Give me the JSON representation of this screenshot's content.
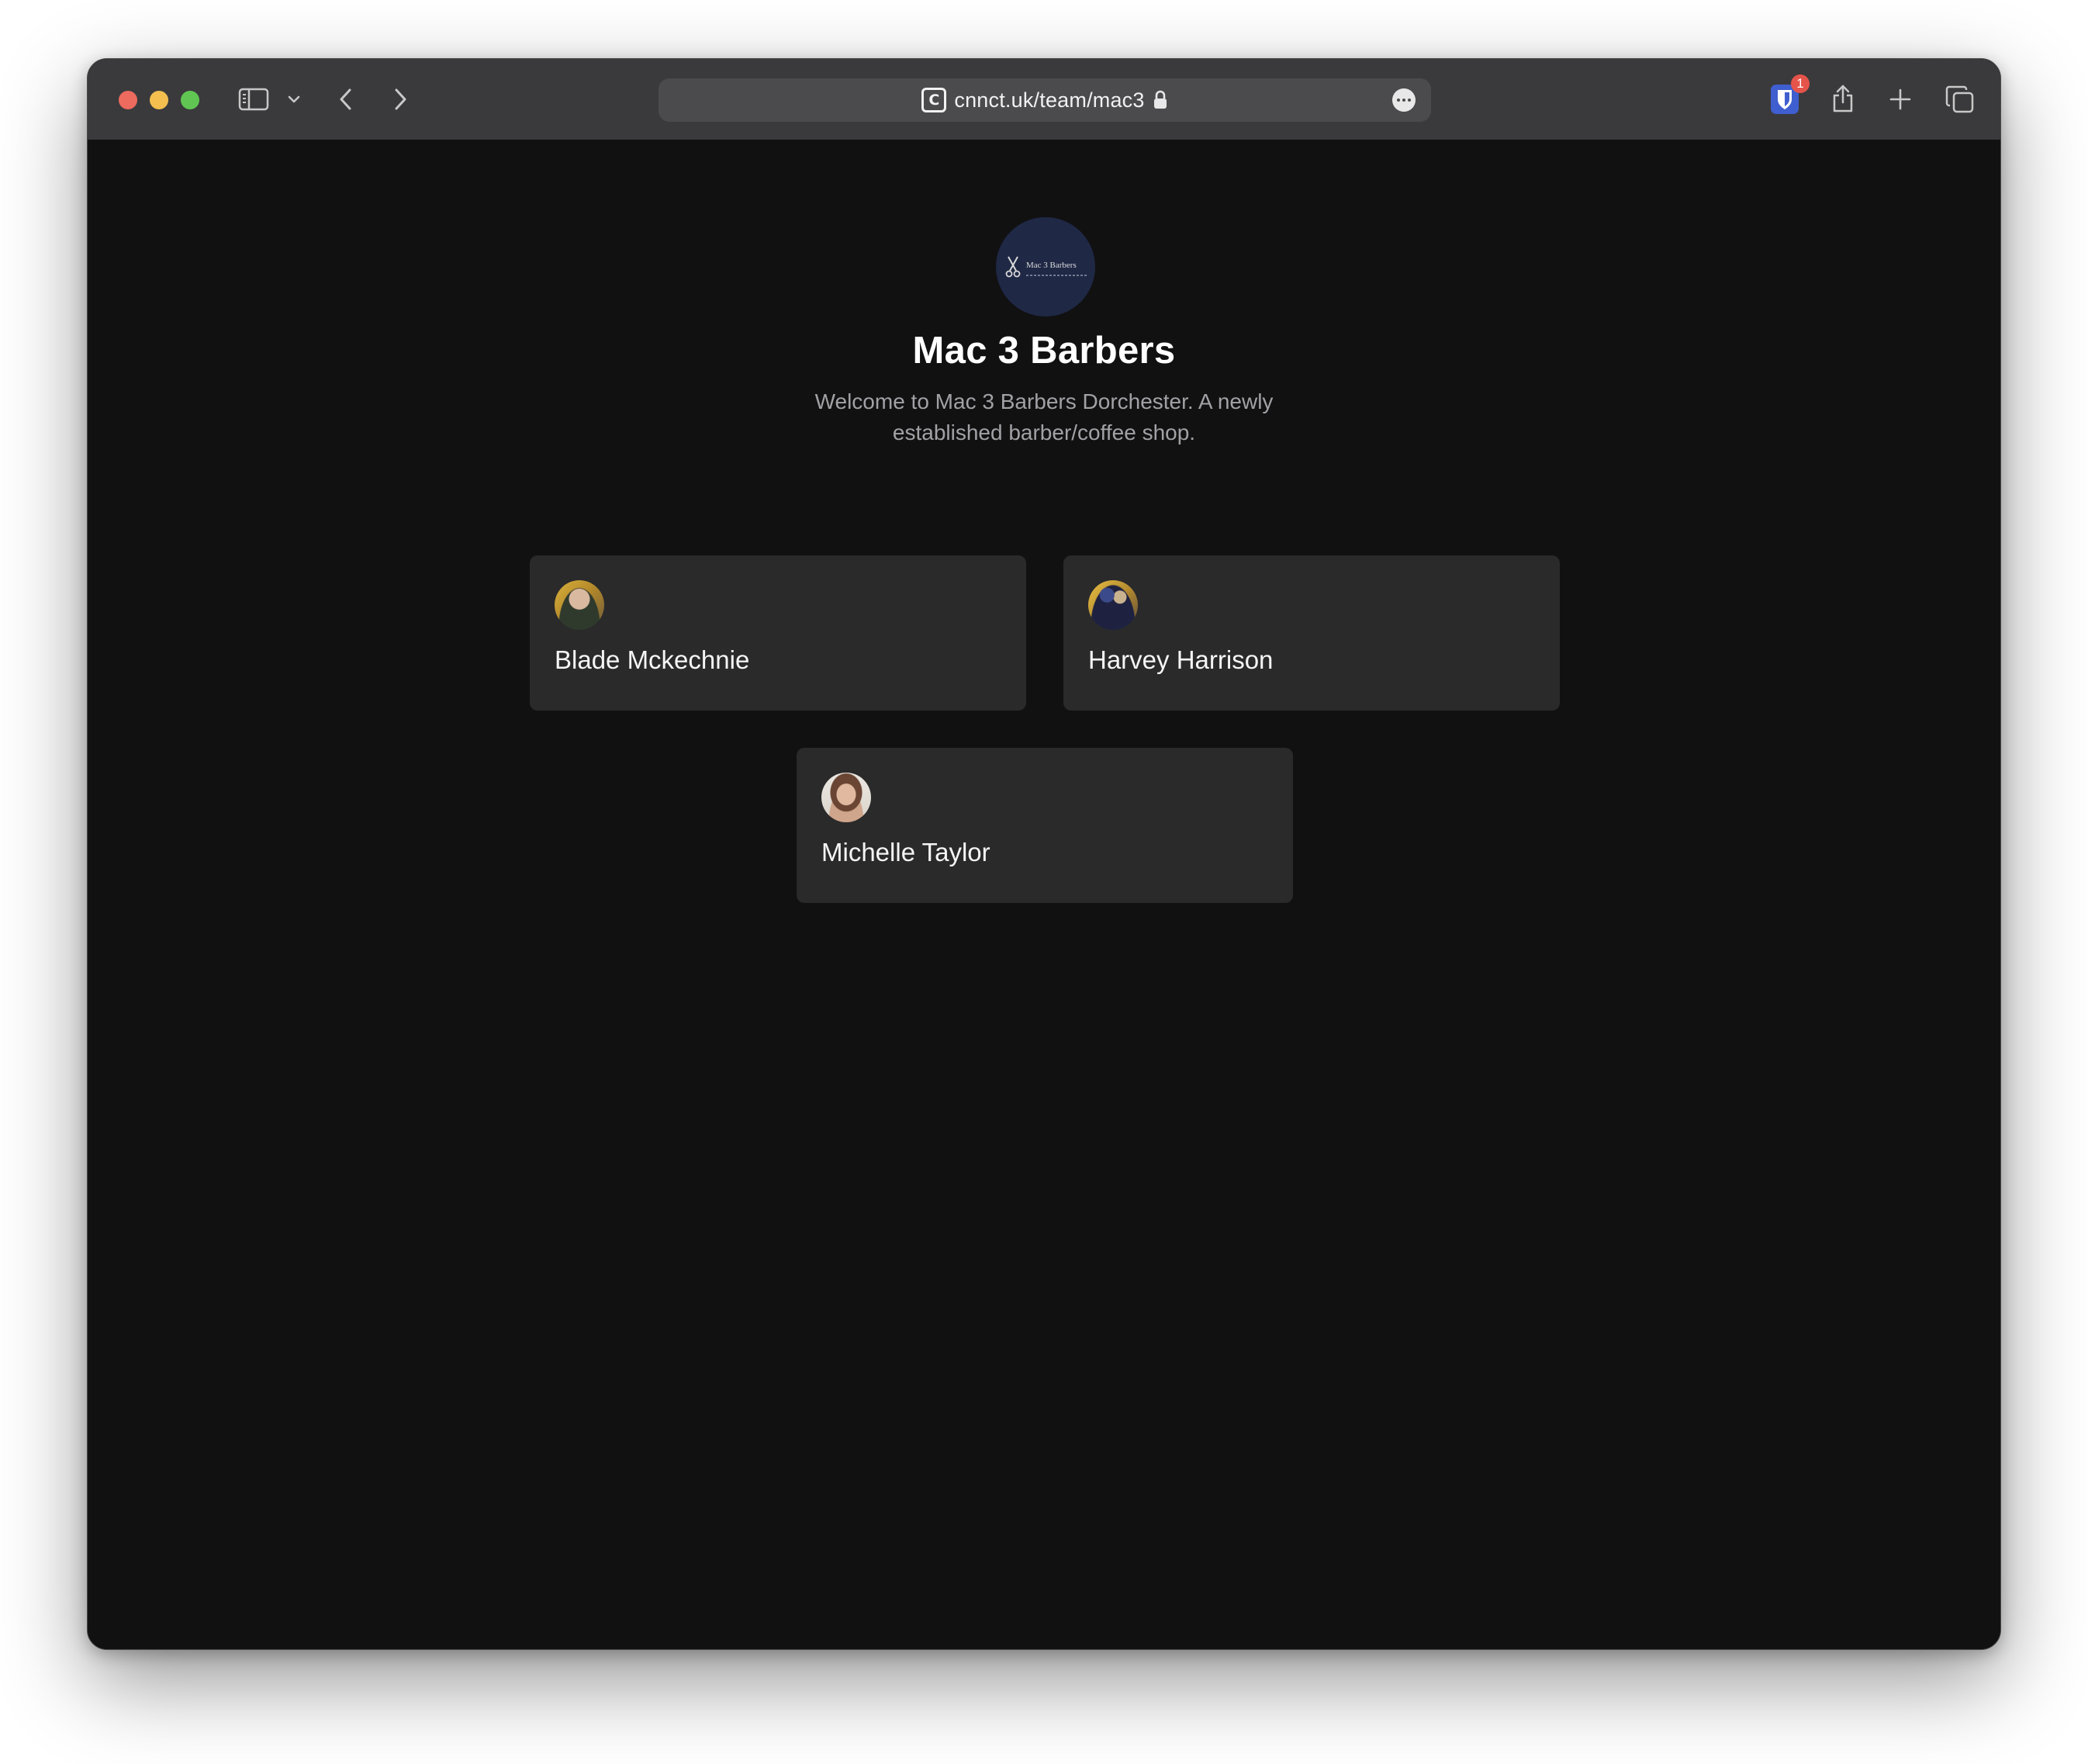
{
  "browser": {
    "url": "cnnct.uk/team/mac3",
    "favicon_letter": "C",
    "extension_badge_count": "1",
    "traffic_colors": {
      "close": "#ec6a5e",
      "minimize": "#f4bf4f",
      "maximize": "#61c554"
    },
    "icons": [
      "sidebar-icon",
      "chevron-down-icon",
      "back-icon",
      "forward-icon",
      "lock-icon",
      "more-icon",
      "bitwarden-shield-icon",
      "share-icon",
      "new-tab-icon",
      "tabs-overview-icon"
    ]
  },
  "page": {
    "logo_text": "Mac 3 Barbers",
    "title": "Mac 3 Barbers",
    "description": "Welcome to Mac 3 Barbers Dorchester. A newly established barber/coffee shop.",
    "background": "#111112",
    "card_background": "#2a2a2b",
    "logo_background": "#1f2845"
  },
  "team": [
    {
      "name": "Blade Mckechnie"
    },
    {
      "name": "Harvey Harrison"
    },
    {
      "name": "Michelle Taylor"
    }
  ]
}
